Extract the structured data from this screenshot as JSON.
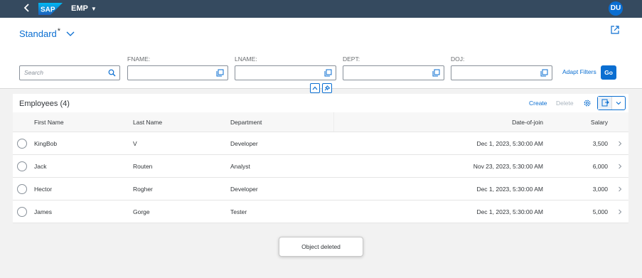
{
  "shell": {
    "logo_text": "SAP",
    "app_title": "EMP",
    "user_initials": "DU",
    "brand_color": "#354a5f",
    "accent_color": "#0a6ed1"
  },
  "header": {
    "variant_name": "Standard",
    "variant_modified_marker": "*",
    "filters": [
      {
        "label": "",
        "placeholder": "Search",
        "icon": "search-icon"
      },
      {
        "label": "FNAME:",
        "value": "",
        "icon": "value-help-icon"
      },
      {
        "label": "LNAME:",
        "value": "",
        "icon": "value-help-icon"
      },
      {
        "label": "DEPT:",
        "value": "",
        "icon": "value-help-icon"
      },
      {
        "label": "DOJ:",
        "value": "",
        "icon": "value-help-icon"
      }
    ],
    "adapt_filters_label": "Adapt Filters",
    "go_label": "Go"
  },
  "table": {
    "title": "Employees (4)",
    "create_label": "Create",
    "delete_label": "Delete",
    "columns": [
      "First Name",
      "Last Name",
      "Department",
      "Date-of-join",
      "Salary"
    ],
    "rows": [
      {
        "first": "KingBob",
        "last": "V",
        "dept": "Developer",
        "doj": "Dec 1, 2023, 5:30:00 AM",
        "salary": "3,500"
      },
      {
        "first": "Jack",
        "last": "Routen",
        "dept": "Analyst",
        "doj": "Nov 23, 2023, 5:30:00 AM",
        "salary": "6,000"
      },
      {
        "first": "Hector",
        "last": "Rogher",
        "dept": "Developer",
        "doj": "Dec 1, 2023, 5:30:00 AM",
        "salary": "3,000"
      },
      {
        "first": "James",
        "last": "Gorge",
        "dept": "Tester",
        "doj": "Dec 1, 2023, 5:30:00 AM",
        "salary": "5,000"
      }
    ]
  },
  "toast": {
    "message": "Object deleted"
  }
}
